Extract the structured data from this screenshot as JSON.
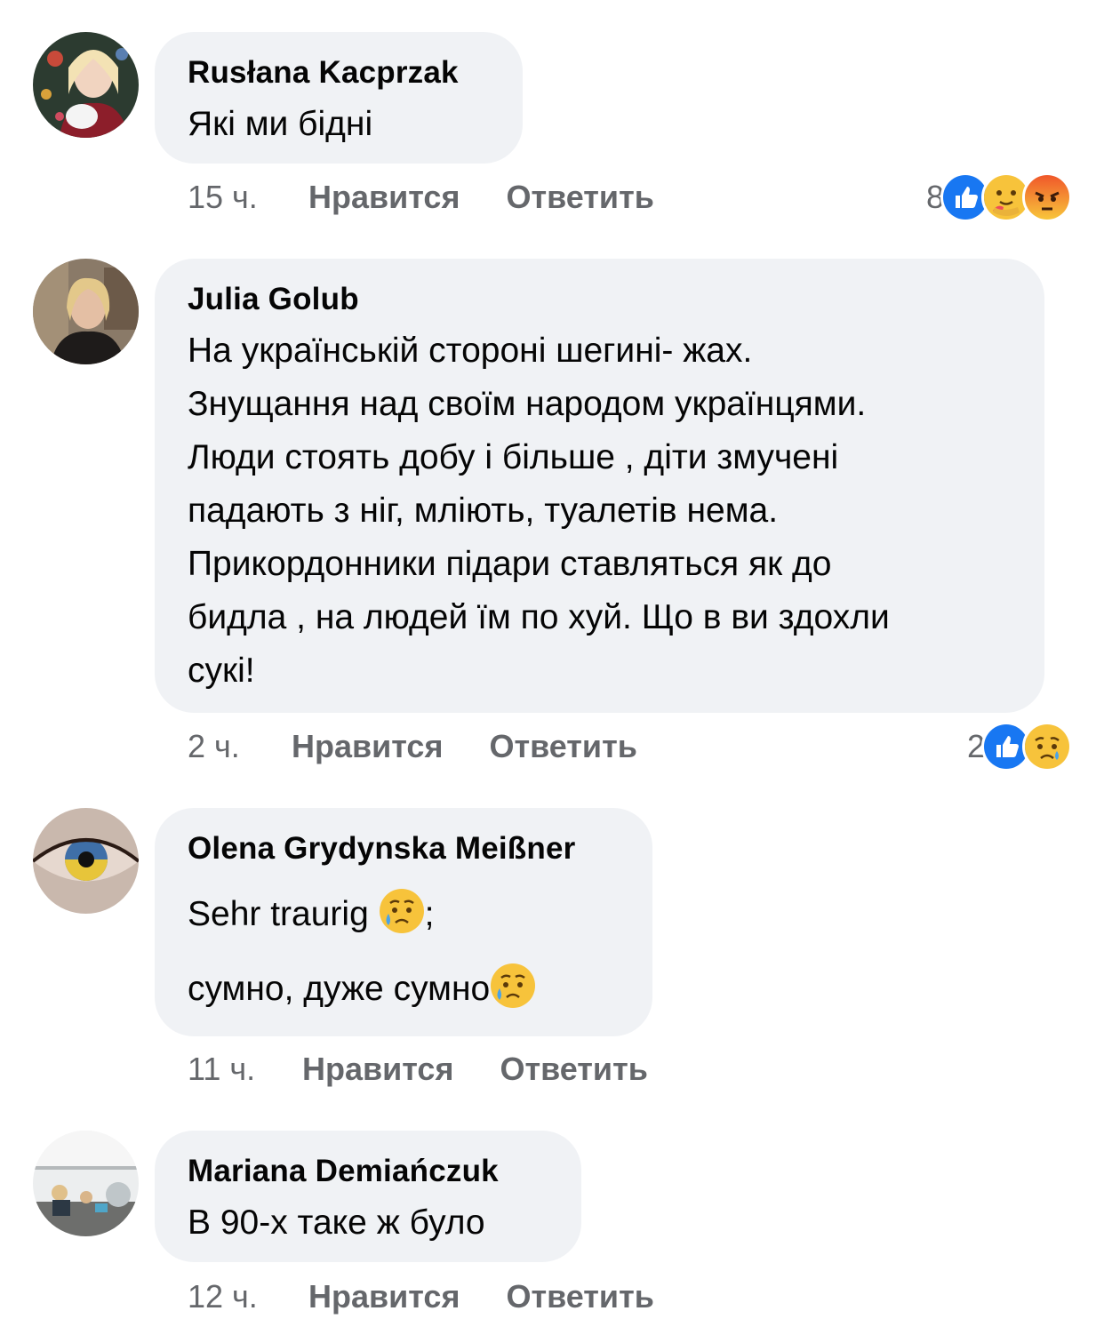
{
  "comments": [
    {
      "author": "Rusłana Kacprzak",
      "lines": [
        "Які ми бідні"
      ],
      "time": "15 ч.",
      "like_label": "Нравится",
      "reply_label": "Ответить",
      "reaction_count": "8",
      "reactions": [
        "like-icon",
        "care-icon",
        "angry-icon"
      ]
    },
    {
      "author": "Julia Golub",
      "lines": [
        "На українській стороні шегині- жах.",
        "Знущання над своїм народом українцями.",
        "Люди стоять добу і більше , діти змучені",
        "падають з ніг, мліють, туалетів нема.",
        "Прикордонники підари ставляться як до",
        "бидла , на людей їм по хуй. Що в ви здохли",
        "сукі!"
      ],
      "time": "2 ч.",
      "like_label": "Нравится",
      "reply_label": "Ответить",
      "reaction_count": "2",
      "reactions": [
        "like-icon",
        "sad-icon"
      ]
    },
    {
      "author": "Olena Grydynska Meißner",
      "line1_text": "Sehr traurig ",
      "line1_suffix": ";",
      "line2_text": "сумно, дуже сумно",
      "time": "11 ч.",
      "like_label": "Нравится",
      "reply_label": "Ответить"
    },
    {
      "author": "Mariana Demiańczuk",
      "lines": [
        "В 90-х таке ж було"
      ],
      "time": "12 ч.",
      "like_label": "Нравится",
      "reply_label": "Ответить"
    }
  ],
  "colors": {
    "bubble": "#f0f2f5",
    "meta_text": "#65676b",
    "like_blue": "#1877f2",
    "angry": "#f0572a",
    "emoji_yellow": "#f7c33b"
  }
}
